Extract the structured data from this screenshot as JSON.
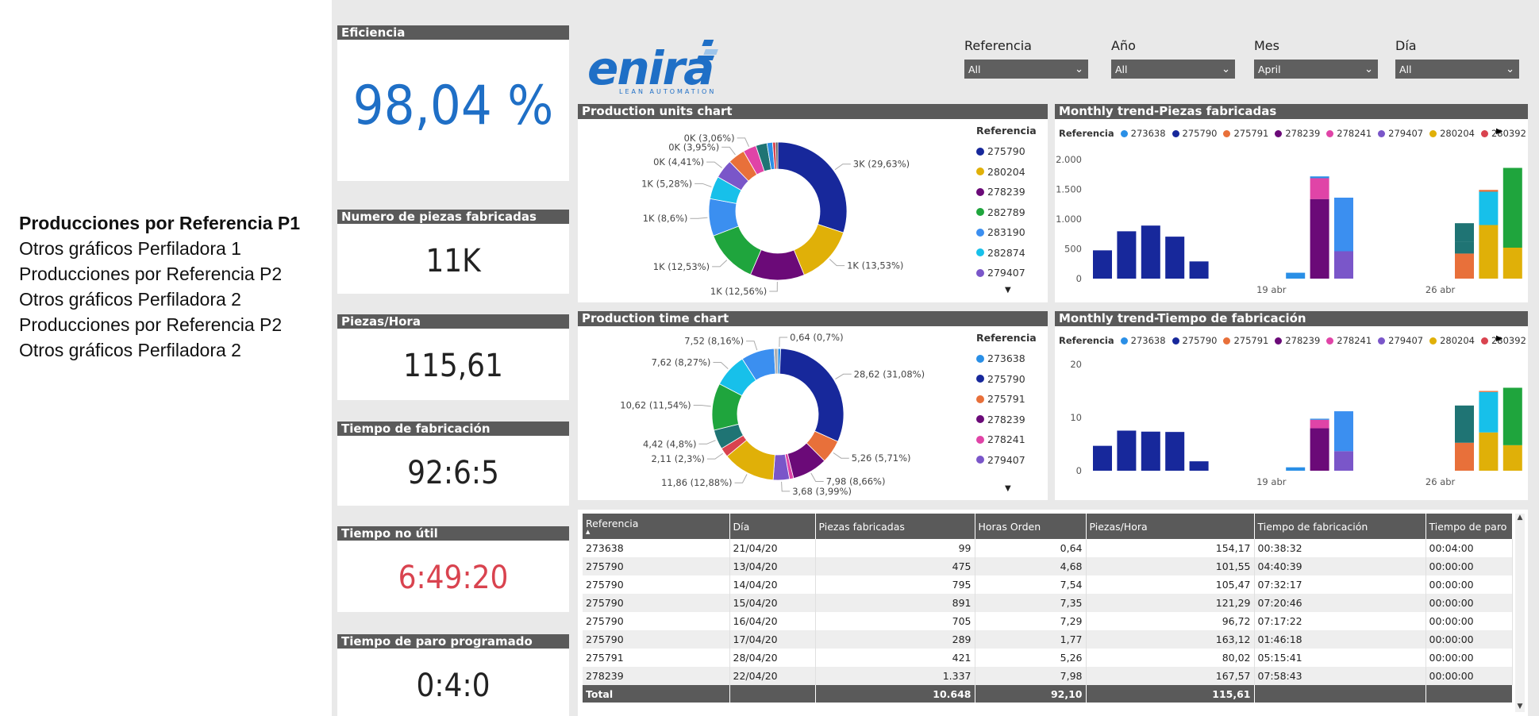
{
  "nav": {
    "items": [
      "Producciones por Referencia P1",
      "Otros gráficos Perfiladora 1",
      "Producciones por Referencia P2",
      "Otros gráficos Perfiladora 2",
      "Producciones por Referencia P2",
      "Otros gráficos Perfiladora 2"
    ]
  },
  "kpis": {
    "eficiencia": {
      "label": "Eficiencia",
      "value": "98,04 %",
      "color": "#1f6fc6"
    },
    "piezas": {
      "label": "Numero de piezas fabricadas",
      "value": "11K"
    },
    "piezas_hora": {
      "label": "Piezas/Hora",
      "value": "115,61"
    },
    "tiempo_fab": {
      "label": "Tiempo de fabricación",
      "value": "92:6:5"
    },
    "tiempo_no_util": {
      "label": "Tiempo no útil",
      "value": "6:49:20",
      "color": "#d9434f"
    },
    "tiempo_paro": {
      "label": "Tiempo de paro programado",
      "value": "0:4:0"
    }
  },
  "logo": {
    "name": "enira",
    "tagline": "LEAN AUTOMATION",
    "color": "#1f6fc6"
  },
  "filters": {
    "referencia": {
      "label": "Referencia",
      "value": "All"
    },
    "anio": {
      "label": "Año",
      "value": "All"
    },
    "mes": {
      "label": "Mes",
      "value": "April"
    },
    "dia": {
      "label": "Día",
      "value": "All"
    }
  },
  "colors": {
    "273638": "#2a8fe6",
    "275790": "#17289b",
    "275791": "#e8703a",
    "278239": "#6b0a78",
    "278241": "#e044a7",
    "279407": "#7a56c9",
    "280204": "#e0b008",
    "280392": "#d9434f",
    "282789": "#1fa53d",
    "283190": "#3b8ff0",
    "282874": "#17c0ea",
    "teal": "#1f7474"
  },
  "units_chart": {
    "title": "Production units chart",
    "legend_title": "Referencia",
    "legend": [
      "275790",
      "280204",
      "278239",
      "282789",
      "283190",
      "282874",
      "279407"
    ],
    "chart_data": {
      "type": "pie",
      "slices": [
        {
          "ref": "275790",
          "label": "3K (29,63%)",
          "value": 29.63,
          "color": "#17289b"
        },
        {
          "ref": "280204",
          "label": "1K (13,53%)",
          "value": 13.53,
          "color": "#e0b008"
        },
        {
          "ref": "278239",
          "label": "1K (12,56%)",
          "value": 12.56,
          "color": "#6b0a78"
        },
        {
          "ref": "282789",
          "label": "1K (12,53%)",
          "value": 12.53,
          "color": "#1fa53d"
        },
        {
          "ref": "283190",
          "label": "1K (8,6%)",
          "value": 8.6,
          "color": "#3b8ff0"
        },
        {
          "ref": "282874",
          "label": "1K (5,28%)",
          "value": 5.28,
          "color": "#17c0ea"
        },
        {
          "ref": "279407",
          "label": "0K (4,41%)",
          "value": 4.41,
          "color": "#7a56c9"
        },
        {
          "ref": "",
          "label": "0K (3,95%)",
          "value": 3.95,
          "color": "#e8703a"
        },
        {
          "ref": "",
          "label": "0K (3,06%)",
          "value": 3.06,
          "color": "#e044a7"
        },
        {
          "ref": "",
          "label": "",
          "value": 2.6,
          "color": "#1f7474"
        },
        {
          "ref": "",
          "label": "",
          "value": 1.3,
          "color": "#2a8fe6"
        },
        {
          "ref": "",
          "label": "",
          "value": 0.7,
          "color": "#d9434f"
        },
        {
          "ref": "",
          "label": "",
          "value": 0.5,
          "color": "#555555"
        }
      ]
    }
  },
  "time_chart": {
    "title": "Production time chart",
    "legend_title": "Referencia",
    "legend": [
      "273638",
      "275790",
      "275791",
      "278239",
      "278241",
      "279407"
    ],
    "chart_data": {
      "type": "pie",
      "slices": [
        {
          "label": "0,64 (0,7%)",
          "value": 0.7,
          "color": "#2a8fe6"
        },
        {
          "label": "28,62 (31,08%)",
          "value": 31.08,
          "color": "#17289b"
        },
        {
          "label": "5,26 (5,71%)",
          "value": 5.71,
          "color": "#e8703a"
        },
        {
          "label": "7,98 (8,66%)",
          "value": 8.66,
          "color": "#6b0a78"
        },
        {
          "label": "",
          "value": 1.0,
          "color": "#e044a7"
        },
        {
          "label": "3,68 (3,99%)",
          "value": 3.99,
          "color": "#7a56c9"
        },
        {
          "label": "11,86 (12,88%)",
          "value": 12.88,
          "color": "#e0b008"
        },
        {
          "label": "2,11 (2,3%)",
          "value": 2.3,
          "color": "#d9434f"
        },
        {
          "label": "4,42 (4,8%)",
          "value": 4.8,
          "color": "#1f7474"
        },
        {
          "label": "10,62 (11,54%)",
          "value": 11.54,
          "color": "#1fa53d"
        },
        {
          "label": "7,62 (8,27%)",
          "value": 8.27,
          "color": "#17c0ea"
        },
        {
          "label": "7,52 (8,16%)",
          "value": 8.16,
          "color": "#3b8ff0"
        },
        {
          "label": "",
          "value": 0.91,
          "color": "#b0b0b0"
        }
      ]
    }
  },
  "trend_legend": {
    "title": "Referencia",
    "items": [
      {
        "ref": "273638",
        "color": "#2a8fe6"
      },
      {
        "ref": "275790",
        "color": "#17289b"
      },
      {
        "ref": "275791",
        "color": "#e8703a"
      },
      {
        "ref": "278239",
        "color": "#6b0a78"
      },
      {
        "ref": "278241",
        "color": "#e044a7"
      },
      {
        "ref": "279407",
        "color": "#7a56c9"
      },
      {
        "ref": "280204",
        "color": "#e0b008"
      },
      {
        "ref": "280392",
        "color": "#d9434f"
      }
    ]
  },
  "trend_units": {
    "title": "Monthly trend-Piezas fabricadas",
    "chart_data": {
      "type": "bar",
      "stacked": true,
      "yticks": [
        "0",
        "500",
        "1.000",
        "1.500",
        "2.000"
      ],
      "ylim": [
        0,
        2000
      ],
      "xlabels": [
        {
          "label": "19 abr",
          "at": 7
        },
        {
          "label": "26 abr",
          "at": 14
        }
      ],
      "slots": 17,
      "bars": [
        {
          "slot": 0,
          "stack": [
            {
              "v": 475,
              "c": "#17289b"
            }
          ]
        },
        {
          "slot": 1,
          "stack": [
            {
              "v": 795,
              "c": "#17289b"
            }
          ]
        },
        {
          "slot": 2,
          "stack": [
            {
              "v": 891,
              "c": "#17289b"
            }
          ]
        },
        {
          "slot": 3,
          "stack": [
            {
              "v": 705,
              "c": "#17289b"
            }
          ]
        },
        {
          "slot": 4,
          "stack": [
            {
              "v": 289,
              "c": "#17289b"
            }
          ]
        },
        {
          "slot": 8,
          "stack": [
            {
              "v": 99,
              "c": "#2a8fe6"
            }
          ]
        },
        {
          "slot": 9,
          "stack": [
            {
              "v": 1337,
              "c": "#6b0a78"
            },
            {
              "v": 350,
              "c": "#e044a7"
            },
            {
              "v": 30,
              "c": "#2a8fe6"
            }
          ]
        },
        {
          "slot": 10,
          "stack": [
            {
              "v": 460,
              "c": "#7a56c9"
            },
            {
              "v": 900,
              "c": "#3b8ff0"
            }
          ]
        },
        {
          "slot": 15,
          "stack": [
            {
              "v": 421,
              "c": "#e8703a"
            },
            {
              "v": 200,
              "c": "#1f7474"
            },
            {
              "v": 310,
              "c": "#1f7474"
            }
          ]
        },
        {
          "slot": 16,
          "stack": [
            {
              "v": 900,
              "c": "#e0b008"
            },
            {
              "v": 560,
              "c": "#17c0ea"
            },
            {
              "v": 30,
              "c": "#e8703a"
            }
          ]
        },
        {
          "slot": 17,
          "stack": [
            {
              "v": 520,
              "c": "#e0b008"
            },
            {
              "v": 1340,
              "c": "#1fa53d"
            }
          ]
        }
      ]
    }
  },
  "trend_time": {
    "title": "Monthly trend-Tiempo de fabricación",
    "chart_data": {
      "type": "bar",
      "stacked": true,
      "yticks": [
        "0",
        "10",
        "20"
      ],
      "ylim": [
        0,
        20
      ],
      "xlabels": [
        {
          "label": "19 abr",
          "at": 7
        },
        {
          "label": "26 abr",
          "at": 14
        }
      ],
      "slots": 17,
      "bars": [
        {
          "slot": 0,
          "stack": [
            {
              "v": 4.68,
              "c": "#17289b"
            }
          ]
        },
        {
          "slot": 1,
          "stack": [
            {
              "v": 7.54,
              "c": "#17289b"
            }
          ]
        },
        {
          "slot": 2,
          "stack": [
            {
              "v": 7.35,
              "c": "#17289b"
            }
          ]
        },
        {
          "slot": 3,
          "stack": [
            {
              "v": 7.29,
              "c": "#17289b"
            }
          ]
        },
        {
          "slot": 4,
          "stack": [
            {
              "v": 1.77,
              "c": "#17289b"
            }
          ]
        },
        {
          "slot": 8,
          "stack": [
            {
              "v": 0.64,
              "c": "#2a8fe6"
            }
          ]
        },
        {
          "slot": 9,
          "stack": [
            {
              "v": 7.98,
              "c": "#6b0a78"
            },
            {
              "v": 1.6,
              "c": "#e044a7"
            },
            {
              "v": 0.2,
              "c": "#2a8fe6"
            }
          ]
        },
        {
          "slot": 10,
          "stack": [
            {
              "v": 3.68,
              "c": "#7a56c9"
            },
            {
              "v": 7.5,
              "c": "#3b8ff0"
            }
          ]
        },
        {
          "slot": 15,
          "stack": [
            {
              "v": 5.26,
              "c": "#e8703a"
            },
            {
              "v": 7.0,
              "c": "#1f7474"
            }
          ]
        },
        {
          "slot": 16,
          "stack": [
            {
              "v": 7.2,
              "c": "#e0b008"
            },
            {
              "v": 7.6,
              "c": "#17c0ea"
            },
            {
              "v": 0.2,
              "c": "#e8703a"
            }
          ]
        },
        {
          "slot": 17,
          "stack": [
            {
              "v": 4.8,
              "c": "#e0b008"
            },
            {
              "v": 10.8,
              "c": "#1fa53d"
            }
          ]
        }
      ]
    }
  },
  "table": {
    "columns": [
      "Referencia",
      "Día",
      "Piezas fabricadas",
      "Horas Orden",
      "Piezas/Hora",
      "Tiempo de fabricación",
      "Tiempo de paro"
    ],
    "rows": [
      [
        "273638",
        "21/04/20",
        "99",
        "0,64",
        "154,17",
        "00:38:32",
        "00:04:00"
      ],
      [
        "275790",
        "13/04/20",
        "475",
        "4,68",
        "101,55",
        "04:40:39",
        "00:00:00"
      ],
      [
        "275790",
        "14/04/20",
        "795",
        "7,54",
        "105,47",
        "07:32:17",
        "00:00:00"
      ],
      [
        "275790",
        "15/04/20",
        "891",
        "7,35",
        "121,29",
        "07:20:46",
        "00:00:00"
      ],
      [
        "275790",
        "16/04/20",
        "705",
        "7,29",
        "96,72",
        "07:17:22",
        "00:00:00"
      ],
      [
        "275790",
        "17/04/20",
        "289",
        "1,77",
        "163,12",
        "01:46:18",
        "00:00:00"
      ],
      [
        "275791",
        "28/04/20",
        "421",
        "5,26",
        "80,02",
        "05:15:41",
        "00:00:00"
      ],
      [
        "278239",
        "22/04/20",
        "1.337",
        "7,98",
        "167,57",
        "07:58:43",
        "00:00:00"
      ]
    ],
    "total": [
      "Total",
      "",
      "10.648",
      "92,10",
      "115,61",
      "",
      ""
    ]
  }
}
